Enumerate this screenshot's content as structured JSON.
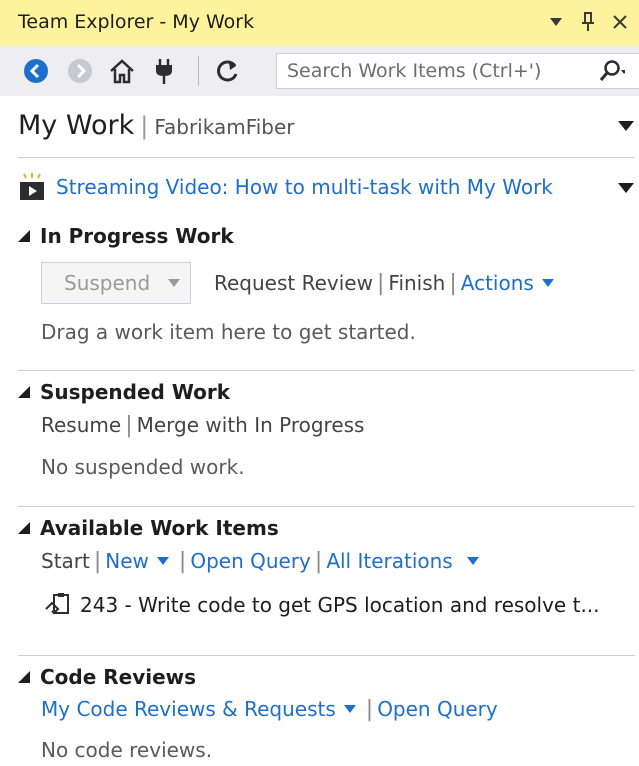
{
  "window": {
    "title": "Team Explorer - My Work",
    "dropdown_glyph": "▼",
    "pin_glyph": "Ꝑ",
    "close_glyph": "✕"
  },
  "toolbar": {
    "icons": [
      "back-icon",
      "forward-icon",
      "home-icon",
      "connect-icon",
      "refresh-icon"
    ],
    "search": {
      "placeholder": "Search Work Items (Ctrl+')",
      "value": ""
    }
  },
  "header": {
    "title": "My Work",
    "separator": "|",
    "project": "FabrikamFiber"
  },
  "video_link": "Streaming Video: How to multi-task with My Work",
  "sections": {
    "in_progress": {
      "title": "In Progress Work",
      "suspend_label": "Suspend",
      "request_review": "Request Review",
      "finish": "Finish",
      "actions": "Actions",
      "message": "Drag a work item here to get started."
    },
    "suspended": {
      "title": "Suspended Work",
      "resume": "Resume",
      "merge": "Merge with In Progress",
      "message": "No suspended work."
    },
    "available": {
      "title": "Available Work Items",
      "start": "Start",
      "new": "New",
      "open_query": "Open Query",
      "iterations": "All Iterations",
      "items": [
        {
          "text": "243 - Write code to get GPS location and resolve t..."
        }
      ]
    },
    "code_reviews": {
      "title": "Code Reviews",
      "my_reviews": "My Code Reviews & Requests",
      "open_query": "Open Query",
      "message": "No code reviews."
    }
  },
  "pipe": "|",
  "colors": {
    "title_bar": "#fff29d",
    "toolbar": "#eeeef2",
    "link": "#1e6fcc",
    "nav_blue": "#1e6fcc"
  }
}
